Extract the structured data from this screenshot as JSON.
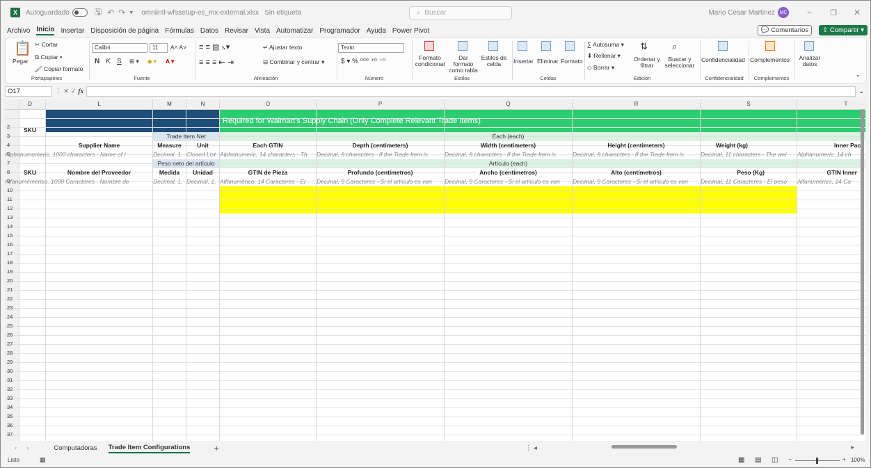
{
  "titlebar": {
    "autosave": "Autoguardado",
    "filename": "omniintl-wfssetup-es_mx-external.xlsx",
    "label": "Sin etiqueta",
    "search": "Buscar",
    "user": "Mario Cesar Martinez",
    "initials": "MC"
  },
  "menu": {
    "items": [
      "Archivo",
      "Inicio",
      "Insertar",
      "Disposición de página",
      "Fórmulas",
      "Datos",
      "Revisar",
      "Vista",
      "Automatizar",
      "Programador",
      "Ayuda",
      "Power Pivot"
    ],
    "comments": "Comentarios",
    "share": "Compartir"
  },
  "ribbon": {
    "clipboard": {
      "paste": "Pegar",
      "cut": "Cortar",
      "copy": "Copiar",
      "format_painter": "Copiar formato",
      "label": "Portapapeles"
    },
    "font": {
      "name": "Calibri",
      "size": "11",
      "label": "Fuente"
    },
    "alignment": {
      "wrap": "Ajustar texto",
      "merge": "Combinar y centrar",
      "label": "Alineación"
    },
    "number": {
      "format": "Texto",
      "label": "Número"
    },
    "styles": {
      "cond": "Formato condicional",
      "table": "Dar formato como tabla",
      "cell": "Estilos de celda",
      "label": "Estilos"
    },
    "cells": {
      "insert": "Insertar",
      "delete": "Eliminar",
      "format": "Formato",
      "label": "Celdas"
    },
    "editing": {
      "autosum": "Autosuma",
      "fill": "Rellenar",
      "clear": "Borrar",
      "sort": "Ordenar y filtrar",
      "find": "Buscar y seleccionar",
      "label": "Edición"
    },
    "sensitivity": {
      "btn": "Confidencialidad",
      "label": "Confidencialidad"
    },
    "addins": {
      "btn": "Complementos",
      "label": "Complementos"
    },
    "analyze": {
      "btn": "Analizar datos"
    }
  },
  "formula_bar": {
    "cell_ref": "O17",
    "content": ""
  },
  "sheet": {
    "columns": [
      "D",
      "L",
      "M",
      "N",
      "O",
      "P",
      "Q",
      "R",
      "S",
      "T"
    ],
    "row_numbers": [
      "2",
      "3",
      "4",
      "6",
      "7",
      "8",
      "9",
      "10",
      "11",
      "12",
      "13",
      "14",
      "15",
      "16",
      "17",
      "18",
      "19",
      "20",
      "21",
      "22",
      "23",
      "24",
      "25",
      "26",
      "27",
      "28",
      "29",
      "30",
      "31",
      "32",
      "33",
      "34",
      "35",
      "36",
      "37"
    ],
    "banner": "Required for Walmart's Supply Chain (Only Complete Relevant Trade Items)",
    "sku": "SKU",
    "group_en_net": "Trade Item Net",
    "group_en_each": "Each (each)",
    "group_es_net": "Peso neto del artículo",
    "group_es_each": "Artículo (each)",
    "headers_en": [
      "Supplier Name",
      "Measure",
      "Unit",
      "Each GTIN",
      "Depth (centimeters)",
      "Width (centimeters)",
      "Height (centimeters)",
      "Weight (kg)",
      "Inner Pack"
    ],
    "desc_en": [
      "Alphanumumeric, 1000 characters - Name of t",
      "Decimal, 1.",
      "Closed List",
      "Alphanumeric, 14 characters - Th",
      "Decimal, 9 characters - If the Trade Item is",
      "Decimal, 9 characters - If the Trade Item is",
      "Decimal, 9 characters - If the Trade Item is",
      "Decimal, 11 characters - The wei",
      "Alphanumeric, 14 ch"
    ],
    "sku_es": "SKU",
    "headers_es": [
      "Nombre del Proveedor",
      "Medida",
      "Unidad",
      "GTIN de Pieza",
      "Profundo (centímetros)",
      "Ancho (centímetros)",
      "Alto (centímetros)",
      "Peso (Kg)",
      "GTIN Inner"
    ],
    "desc_es": [
      "Alfanumémérico, 1000 Caracteres - Nombre de",
      "Decimal, 1.",
      "Decimal, 1.",
      "Alfanumérico, 14 Caracteres - El",
      "Decimal, 9 Caracteres - Si el artículo es ven",
      "Decimal, 9 Caracteres - Si el artículo es ven",
      "Decimal, 9 Caracteres - Si el artículo es ven",
      "Decimal, 11 Caracteres - El peso",
      "Alfanumérico, 14 Ca"
    ]
  },
  "tabs": [
    "Computadoras",
    "Trade Item Configurations"
  ],
  "status": {
    "ready": "Listo",
    "zoom": "100%"
  },
  "colors": {
    "navy": "#1f4e79",
    "green": "#2ecc71",
    "light_green": "#d9f2e1",
    "light_blue": "#dbe5f1",
    "yellow": "#ffff00",
    "excel": "#1d6f42"
  }
}
